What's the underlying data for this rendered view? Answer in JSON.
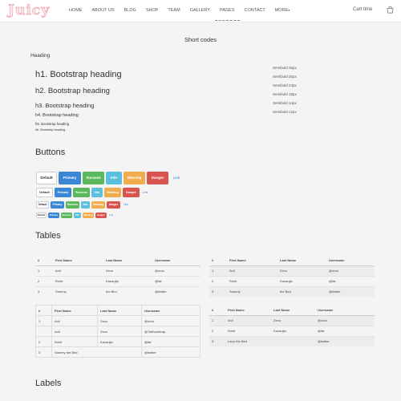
{
  "brand": "Juicy",
  "nav": [
    "HOME",
    "ABOUT US",
    "BLOG",
    "SHOP",
    "TEAM",
    "GALLERY",
    "PAGES",
    "CONTACT",
    "MORE"
  ],
  "cart_label": "Cart time",
  "page_title": "Short codes",
  "sections": {
    "heading": "Heading",
    "buttons": "Buttons",
    "tables": "Tables",
    "labels": "Labels"
  },
  "headings": [
    "h1. Bootstrap heading",
    "h2. Bootstrap heading",
    "h3. Bootstrap heading",
    "h4. Bootstrap heading",
    "h5. Bootstrap heading",
    "h6. Bootstrap heading"
  ],
  "semibold": [
    "Semibold 36px",
    "Semibold 30px",
    "Semibold 24px",
    "Semibold 18px",
    "Semibold 14px",
    "Semibold 12px"
  ],
  "buttons": [
    "Default",
    "Primary",
    "Success",
    "Info",
    "Warning",
    "Danger",
    "Link"
  ],
  "tables": {
    "headers": [
      "#",
      "First Name",
      "Last Name",
      "Username"
    ],
    "basic_rows": [
      [
        "1",
        "Anil",
        "Zeno",
        "@mdo"
      ],
      [
        "2",
        "Rohit",
        "Kanaujia",
        "@fat"
      ],
      [
        "3",
        "Sammy",
        "the Bird",
        "@twitter"
      ]
    ],
    "bordered_rows": [
      [
        "1",
        "Anil",
        "Zeno",
        "@mdo"
      ],
      [
        "",
        "Anil",
        "Zeno",
        "@TwBootstrap"
      ],
      [
        "2",
        "Rohit",
        "Kanaujia",
        "@fat"
      ],
      [
        "3",
        "Sammy the Bird",
        "",
        "@twitter"
      ]
    ],
    "striped_rows": [
      [
        "1",
        "Anil",
        "Zeno",
        "@mdo"
      ],
      [
        "2",
        "Rohit",
        "Kanaujia",
        "@fat"
      ],
      [
        "3",
        "Larry the Bird",
        "",
        "@twitter"
      ]
    ]
  }
}
